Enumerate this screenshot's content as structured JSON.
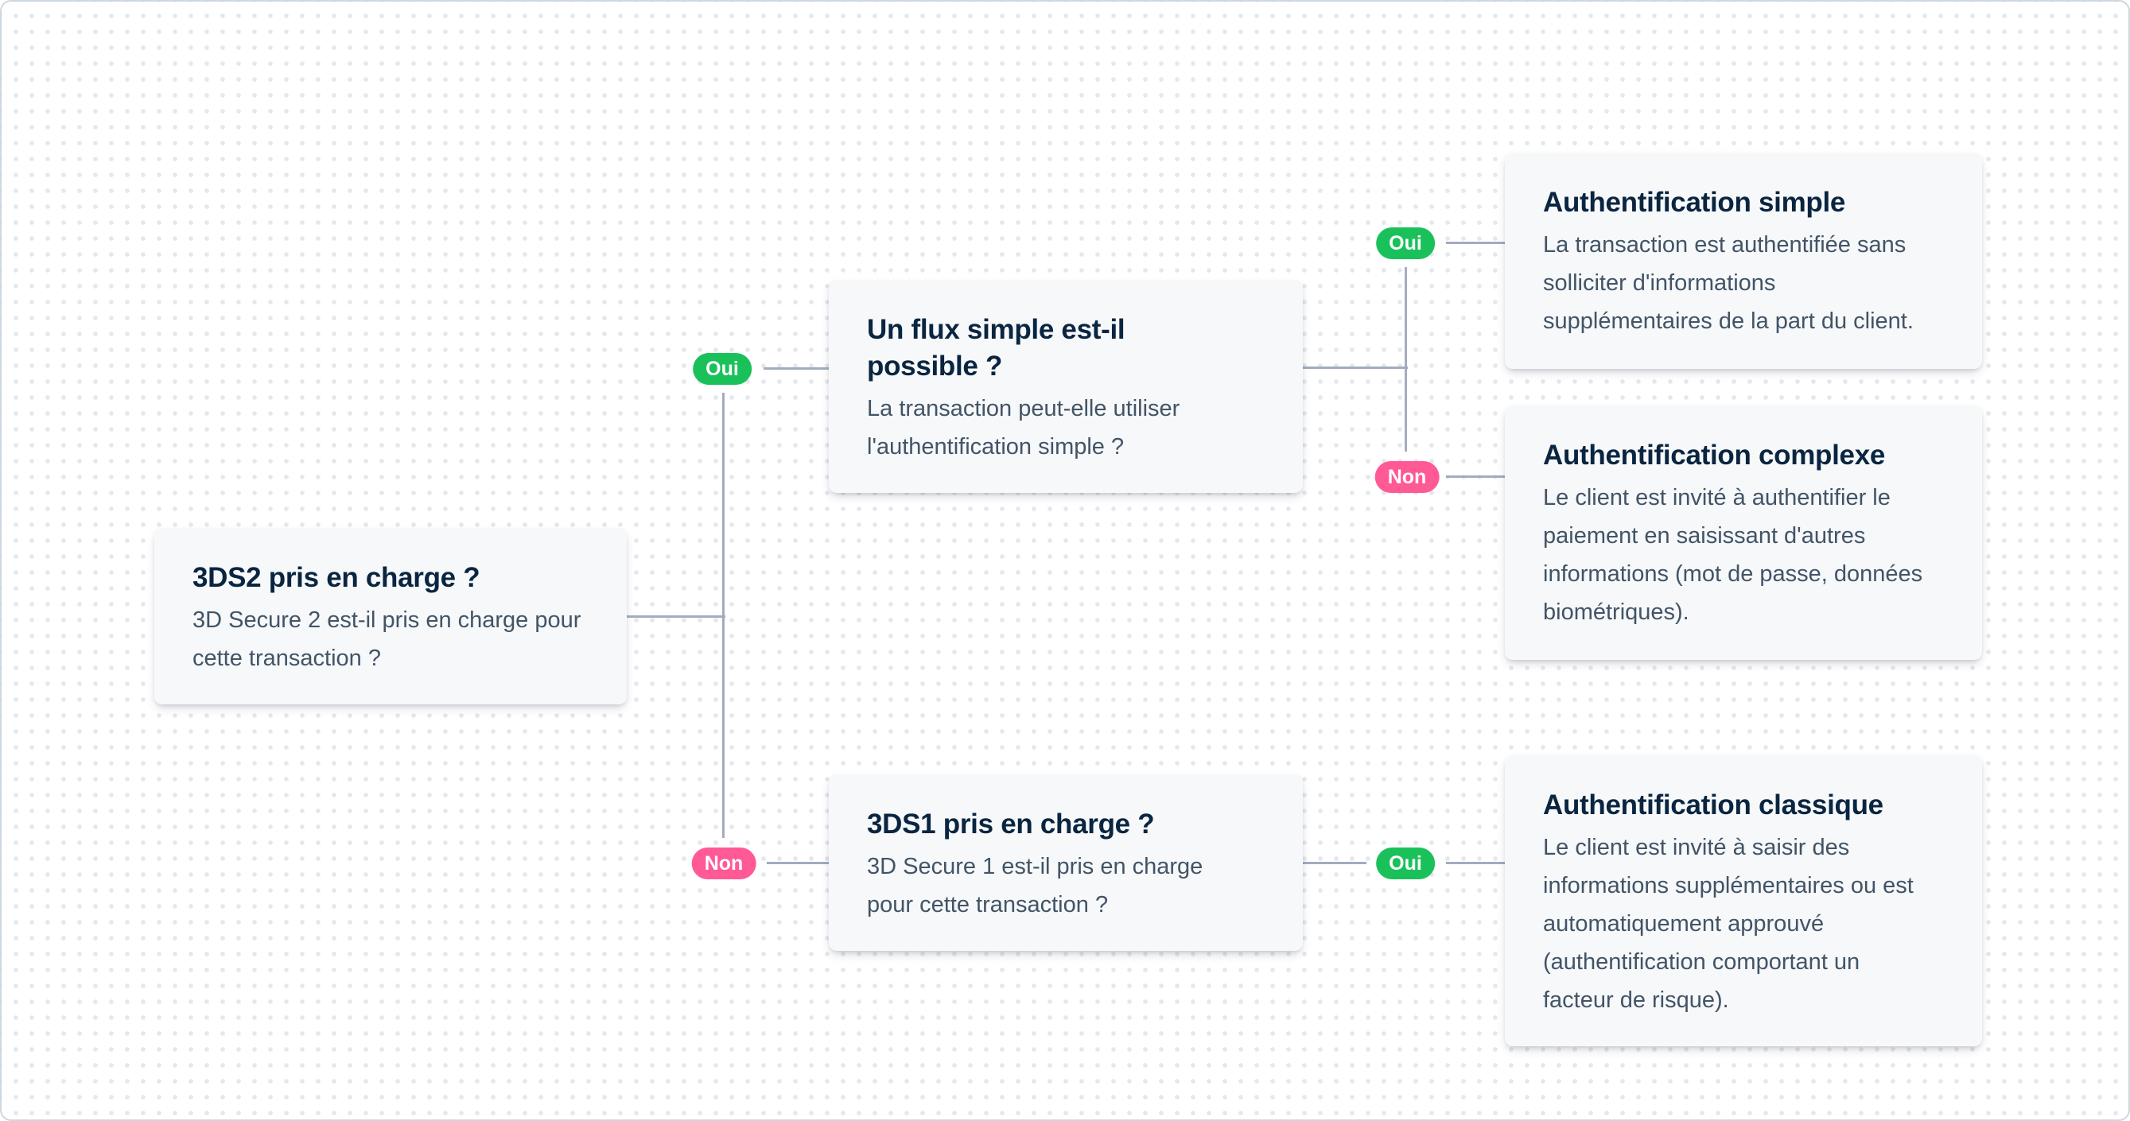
{
  "colors": {
    "yes": "#1ac15a",
    "no": "#ff5996",
    "connector": "#a3acbf",
    "title": "#0a2540",
    "body": "#425466",
    "card_bg": "#f6f8fa"
  },
  "nodes": {
    "start": {
      "title": "3DS2 pris en charge ?",
      "body": "3D Secure 2 est-il pris en charge pour cette transaction ?"
    },
    "frictionless_check": {
      "title": "Un flux simple est-il possible ?",
      "body": "La transaction peut-elle utiliser l'authentification simple ?"
    },
    "3ds1_check": {
      "title": "3DS1 pris en charge ?",
      "body": "3D Secure 1 est-il pris en charge pour cette transaction ?"
    },
    "frictionless": {
      "title": "Authentification simple",
      "body": "La transaction est authentifiée sans solliciter d'informations supplémentaires de la part du client."
    },
    "challenge": {
      "title": "Authentification complexe",
      "body": "Le client est invité à authentifier le paiement en saisissant d'autres informations (mot de passe, données biométriques)."
    },
    "classic": {
      "title": "Authentification classique",
      "body": "Le client est invité à saisir des informations supplémentaires ou est automatiquement approuvé (authentification comportant un facteur de risque)."
    }
  },
  "edges": [
    {
      "from": "start",
      "to": "frictionless_check",
      "label": "Oui",
      "kind": "yes"
    },
    {
      "from": "start",
      "to": "3ds1_check",
      "label": "Non",
      "kind": "no"
    },
    {
      "from": "frictionless_check",
      "to": "frictionless",
      "label": "Oui",
      "kind": "yes"
    },
    {
      "from": "frictionless_check",
      "to": "challenge",
      "label": "Non",
      "kind": "no"
    },
    {
      "from": "3ds1_check",
      "to": "classic",
      "label": "Oui",
      "kind": "yes"
    }
  ]
}
